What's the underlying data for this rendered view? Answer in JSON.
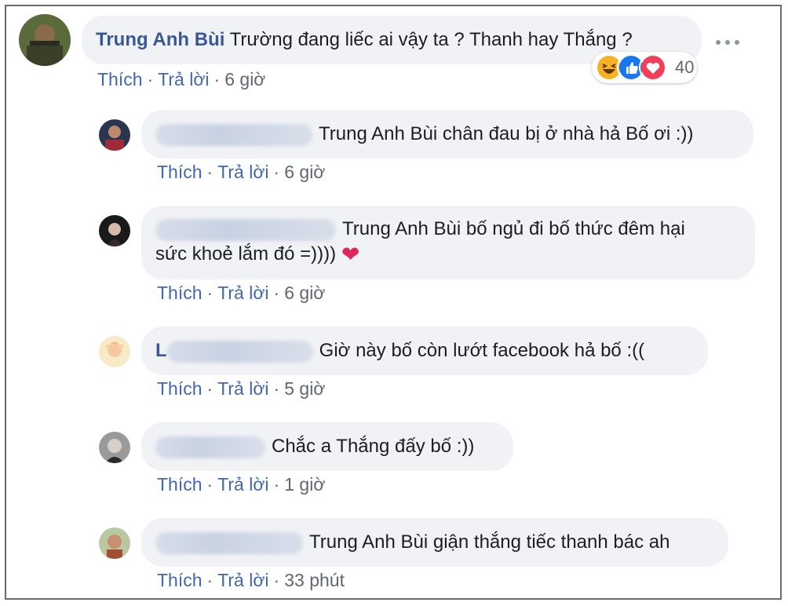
{
  "top_comment": {
    "author": "Trung Anh Bùi",
    "text": "Trường đang liếc ai vậy ta ? Thanh hay Thắng ?",
    "like_label": "Thích",
    "reply_label": "Trả lời",
    "time": "6 giờ",
    "reaction_count": "40",
    "reactions": [
      "haha-icon",
      "like-icon",
      "love-icon"
    ]
  },
  "replies": [
    {
      "text": "Trung Anh Bùi chân đau bị ở nhà hả Bố ơi :))",
      "like_label": "Thích",
      "reply_label": "Trả lời",
      "time": "6 giờ"
    },
    {
      "text_line1": "Trung Anh Bùi bố ngủ đi bố thức đêm hại",
      "text_line2": "sức khoẻ lắm đó =))))",
      "emoji": "❤",
      "like_label": "Thích",
      "reply_label": "Trả lời",
      "time": "6 giờ"
    },
    {
      "name_prefix": "L",
      "text": "Giờ này bố còn lướt facebook hả bố :((",
      "like_label": "Thích",
      "reply_label": "Trả lời",
      "time": "5 giờ"
    },
    {
      "text": "Chắc a Thắng đấy bố :))",
      "like_label": "Thích",
      "reply_label": "Trả lời",
      "time": "1 giờ"
    },
    {
      "text": "Trung Anh Bùi giận thắng tiếc thanh bác ah",
      "like_label": "Thích",
      "reply_label": "Trả lời",
      "time": "33 phút"
    }
  ],
  "colors": {
    "link": "#4267b2",
    "name": "#385898",
    "bubble": "#f0f2f5",
    "meta": "#606770"
  }
}
